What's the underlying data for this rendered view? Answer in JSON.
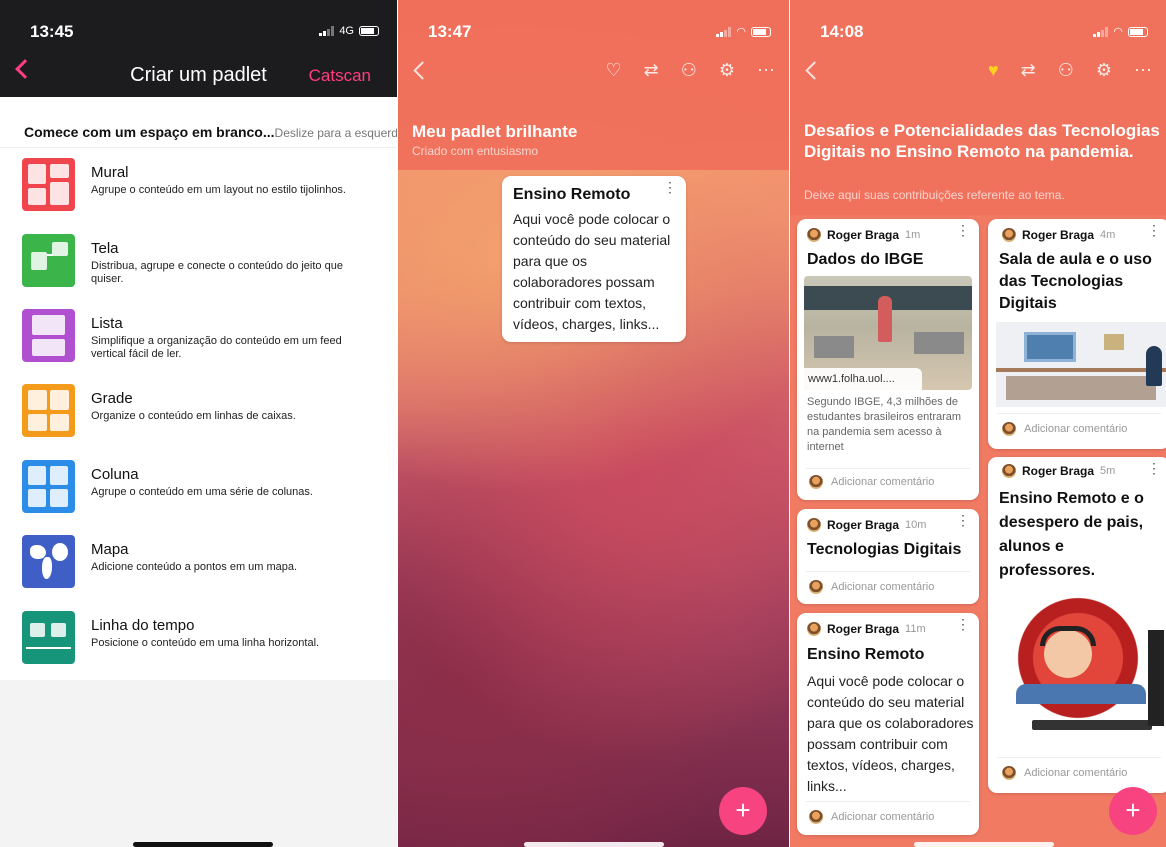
{
  "screen1": {
    "time": "13:45",
    "network": "4G",
    "header_title": "Criar um padlet",
    "header_action": "Catscan",
    "intro_bold": "Comece com um espaço em branco...",
    "intro_hint": "Deslize para a esquerda para p",
    "layouts": [
      {
        "name": "Mural",
        "desc": "Agrupe o conteúdo em um layout no estilo tijolinhos.",
        "color": "#f0454c",
        "icon": "mural-icon"
      },
      {
        "name": "Tela",
        "desc": "Distribua, agrupe e conecte o conteúdo do jeito que quiser.",
        "color": "#3bb54a",
        "icon": "canvas-icon"
      },
      {
        "name": "Lista",
        "desc": "Simplifique a organização do conteúdo em um feed vertical fácil de ler.",
        "color": "#b04fd0",
        "icon": "list-icon"
      },
      {
        "name": "Grade",
        "desc": "Organize o conteúdo em linhas de caixas.",
        "color": "#f59b1b",
        "icon": "grid-icon"
      },
      {
        "name": "Coluna",
        "desc": "Agrupe o conteúdo em uma série de colunas.",
        "color": "#2c8de8",
        "icon": "column-icon"
      },
      {
        "name": "Mapa",
        "desc": "Adicione conteúdo a pontos em um mapa.",
        "color": "#3f5fc6",
        "icon": "map-icon"
      },
      {
        "name": "Linha do tempo",
        "desc": "Posicione o conteúdo em uma linha horizontal.",
        "color": "#16957a",
        "icon": "timeline-icon"
      }
    ]
  },
  "screen2": {
    "time": "13:47",
    "title": "Meu padlet brilhante",
    "subtitle": "Criado com entusiasmo",
    "card": {
      "title": "Ensino Remoto",
      "body": "Aqui você pode colocar o conteúdo do seu material para que os colaboradores possam contribuir com textos, vídeos, charges, links..."
    },
    "fab": "+"
  },
  "screen3": {
    "time": "14:08",
    "title": "Desafios e Potencialidades das Tecnologias Digitais no Ensino Remoto na pandemia.",
    "subtitle": "Deixe aqui suas contribuições referente ao tema.",
    "add_comment": "Adicionar comentário",
    "fab": "+",
    "posts": [
      {
        "author": "Roger Braga",
        "time": "1m",
        "title": "Dados do IBGE",
        "link": "www1.folha.uol....",
        "body": "Segundo IBGE, 4,3 milhões de estudantes brasileiros entraram na pandemia sem acesso à internet"
      },
      {
        "author": "Roger Braga",
        "time": "10m",
        "title": "Tecnologias Digitais"
      },
      {
        "author": "Roger Braga",
        "time": "11m",
        "title": "Ensino Remoto",
        "body": "Aqui você pode colocar o conteúdo do seu material para que os colaboradores possam contribuir com textos, vídeos, charges, links..."
      },
      {
        "author": "Roger Braga",
        "time": "4m",
        "title": "Sala de aula e o uso das Tecnologias Digitais"
      },
      {
        "author": "Roger Braga",
        "time": "5m",
        "title": "Ensino Remoto e o desespero de pais, alunos e professores."
      }
    ]
  }
}
